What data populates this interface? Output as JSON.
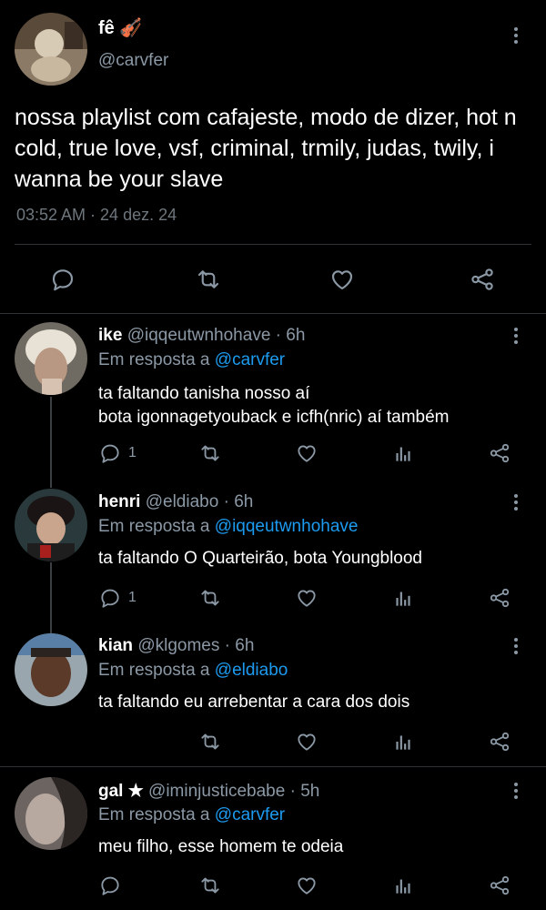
{
  "tweet": {
    "author_name": "fê 🎻",
    "handle": "@carvfer",
    "text": "nossa playlist com cafajeste, modo de dizer, hot n cold, true love, vsf, criminal, trmily, judas, twily, i wanna be your slave",
    "timestamp": "03:52 AM · 24 dez. 24",
    "actions": [
      "reply-icon",
      "retweet-icon",
      "like-icon",
      "share-icon"
    ]
  },
  "replies": [
    {
      "name": "ike",
      "handle": "@iqqeutwnhohave",
      "time": "6h",
      "replying_label": "Em resposta a",
      "replying_to": "@carvfer",
      "lines": [
        "ta faltando tanisha nosso aí",
        "bota igonnagetyouback e icfh(nric) aí também"
      ],
      "reply_count": "1"
    },
    {
      "name": "henri",
      "handle": "@eldiabo",
      "time": "6h",
      "replying_label": "Em resposta a",
      "replying_to": "@iqqeutwnhohave",
      "lines": [
        "ta faltando O Quarteirão, bota Youngblood"
      ],
      "reply_count": "1"
    },
    {
      "name": "kian",
      "handle": "@klgomes",
      "time": "6h",
      "replying_label": "Em resposta a",
      "replying_to": "@eldiabo",
      "lines": [
        "ta faltando eu arrebentar a cara dos dois"
      ],
      "reply_count": ""
    },
    {
      "name": "gal ★",
      "handle": "@iminjusticebabe",
      "time": "5h",
      "replying_label": "Em resposta a",
      "replying_to": "@carvfer",
      "lines": [
        "meu filho, esse homem te odeia"
      ],
      "reply_count": ""
    }
  ],
  "colors": {
    "background": "#000000",
    "text": "#e7e9ea",
    "secondary": "#8b98a5",
    "link": "#1d9bf0",
    "divider": "#2f3336"
  }
}
